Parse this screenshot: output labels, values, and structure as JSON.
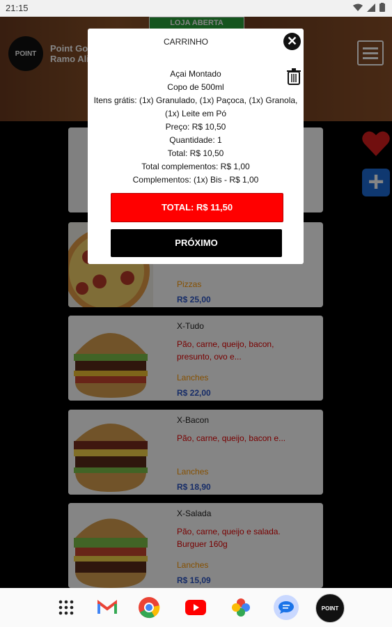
{
  "status_bar": {
    "time": "21:15"
  },
  "header": {
    "store_badge": "LOJA ABERTA",
    "logo_text": "POINT",
    "store_name_line1": "Point Gos",
    "store_name_line2": "Ramo Ali"
  },
  "products": [
    {
      "name": "",
      "description": "",
      "category": "",
      "price": ""
    },
    {
      "name": "",
      "description": "",
      "category": "Pizzas",
      "price": "R$ 25,00"
    },
    {
      "name": "X-Tudo",
      "description": "Pão, carne, queijo, bacon, presunto, ovo e...",
      "category": "Lanches",
      "price": "R$ 22,00"
    },
    {
      "name": "X-Bacon",
      "description": "Pão, carne, queijo, bacon e...",
      "category": "Lanches",
      "price": "R$ 18,90"
    },
    {
      "name": "X-Salada",
      "description": "Pão, carne, queijo e salada. Burguer 160g",
      "category": "Lanches",
      "price": "R$ 15,09"
    }
  ],
  "modal": {
    "title": "CARRINHO",
    "item_name": "Açai Montado",
    "size": "Copo de 500ml",
    "free_items": "Itens grátis: (1x) Granulado, (1x) Paçoca, (1x) Granola, (1x) Leite em Pó",
    "price": "Preço: R$ 10,50",
    "quantity": "Quantidade: 1",
    "total": "Total: R$ 10,50",
    "total_complements": "Total complementos: R$ 1,00",
    "complements": "Complementos: (1x) Bis - R$ 1,00",
    "total_button": "TOTAL: R$ 11,50",
    "next_button": "PRÓXIMO"
  },
  "colors": {
    "accent_red": "#ff0000",
    "store_open_green": "#2aa33a",
    "price_blue": "#2c56c7",
    "category_orange": "#ff9800"
  },
  "icons": [
    "wifi-icon",
    "signal-icon",
    "battery-icon",
    "menu-icon",
    "heart-icon",
    "plus-icon",
    "close-icon",
    "trash-icon",
    "app-drawer-icon",
    "gmail-icon",
    "chrome-icon",
    "youtube-icon",
    "photos-icon",
    "messages-icon",
    "point-app-icon"
  ]
}
